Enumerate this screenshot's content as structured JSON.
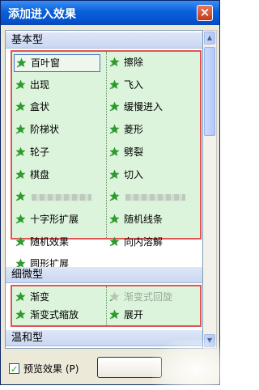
{
  "window": {
    "title": "添加进入效果",
    "close_symbol": "×"
  },
  "sections": [
    {
      "label": "基本型",
      "items": [
        {
          "label": "百叶窗",
          "icon": "star-icon",
          "selected": true
        },
        {
          "label": "擦除",
          "icon": "star-icon"
        },
        {
          "label": "出现",
          "icon": "star-icon"
        },
        {
          "label": "飞入",
          "icon": "star-icon"
        },
        {
          "label": "盒状",
          "icon": "star-icon"
        },
        {
          "label": "缓慢进入",
          "icon": "star-icon"
        },
        {
          "label": "阶梯状",
          "icon": "star-icon"
        },
        {
          "label": "菱形",
          "icon": "star-icon"
        },
        {
          "label": "轮子",
          "icon": "star-icon"
        },
        {
          "label": "劈裂",
          "icon": "star-icon"
        },
        {
          "label": "棋盘",
          "icon": "star-icon"
        },
        {
          "label": "切入",
          "icon": "star-icon"
        },
        {
          "label": "",
          "icon": "star-icon",
          "obscured": true
        },
        {
          "label": "",
          "icon": "star-icon",
          "obscured": true
        },
        {
          "label": "十字形扩展",
          "icon": "star-icon"
        },
        {
          "label": "随机线条",
          "icon": "star-icon"
        },
        {
          "label": "随机效果",
          "icon": "star-icon"
        },
        {
          "label": "向内溶解",
          "icon": "star-icon"
        },
        {
          "label": "圆形扩展",
          "icon": "star-icon"
        }
      ]
    },
    {
      "label": "细微型",
      "items": [
        {
          "label": "渐变",
          "icon": "star-icon"
        },
        {
          "label": "渐变式回旋",
          "icon": "star-icon",
          "disabled": true
        },
        {
          "label": "渐变式缩放",
          "icon": "star-icon"
        },
        {
          "label": "展开",
          "icon": "star-icon"
        }
      ]
    },
    {
      "label": "温和型",
      "items": []
    }
  ],
  "footer": {
    "preview_label": "预览效果 (P)",
    "preview_checked": true,
    "ok_label": ""
  },
  "colors": {
    "title_bar": "#0a5fd8",
    "highlight_fill": "#dcf4dc",
    "highlight_border": "#e05454",
    "category_bar": "#c9d7f1",
    "star": "#2f9a2f"
  }
}
